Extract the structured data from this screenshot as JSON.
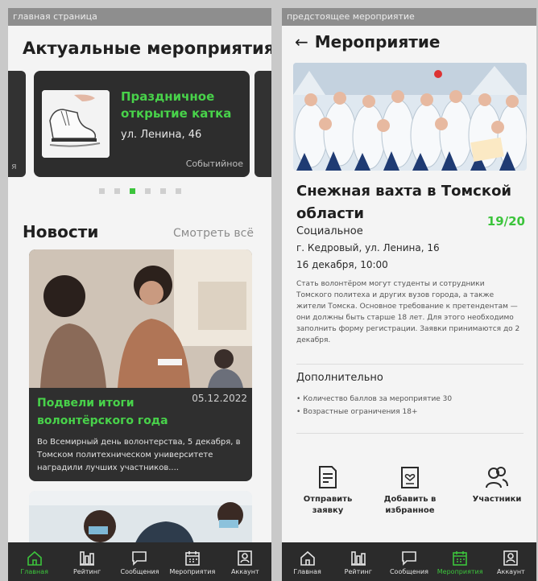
{
  "left_screen": {
    "caption": "главная страница",
    "section_title": "Актуальные мероприятия",
    "prev_card_fragment": "я",
    "event_card": {
      "title": "Праздничное открытие катка",
      "address": "ул. Ленина, 46",
      "category": "Событийное"
    },
    "carousel": {
      "total": 6,
      "active_index": 2
    },
    "news": {
      "title": "Новости",
      "see_all": "Смотреть всё",
      "card": {
        "date": "05.12.2022",
        "title": "Подвели итоги волонтёрского года",
        "text": "Во Всемирный день волонтерства, 5 декабря, в Томском политехническом университете наградили лучших участников...."
      }
    },
    "tabbar": {
      "active": "home",
      "items": [
        {
          "id": "home",
          "label": "Главная",
          "icon": "home-icon"
        },
        {
          "id": "rating",
          "label": "Рейтинг",
          "icon": "chart-icon"
        },
        {
          "id": "messages",
          "label": "Сообщения",
          "icon": "message-icon"
        },
        {
          "id": "events",
          "label": "Мероприятия",
          "icon": "calendar-icon"
        },
        {
          "id": "account",
          "label": "Аккаунт",
          "icon": "user-icon"
        }
      ]
    }
  },
  "right_screen": {
    "caption": "предстоящее мероприятие",
    "header_title": "Мероприятие",
    "event": {
      "title": "Снежная вахта в Томской области",
      "participants": "19/20",
      "category": "Социальное",
      "address": "г. Кедровый, ул. Ленина, 16",
      "datetime": "16 декабря, 10:00",
      "description": "Стать волонтёром могут студенты и сотрудники Томского политеха и других вузов города, а также жители Томска. Основное требование к претендентам — они должны быть старше 18 лет. Для этого необходимо заполнить форму регистрации. Заявки принимаются до 2 декабря."
    },
    "extra": {
      "title": "Дополнительно",
      "items": [
        "Количество баллов за мероприятие 30",
        "Возрастные ограничения 18+"
      ]
    },
    "actions": [
      {
        "label": "Отправить заявку",
        "icon": "document-icon"
      },
      {
        "label": "Добавить в избранное",
        "icon": "favorite-clipboard-icon"
      },
      {
        "label": "Участники",
        "icon": "participants-icon"
      }
    ],
    "tabbar": {
      "active": "events",
      "items": [
        {
          "id": "home",
          "label": "Главная",
          "icon": "home-icon"
        },
        {
          "id": "rating",
          "label": "Рейтинг",
          "icon": "chart-icon"
        },
        {
          "id": "messages",
          "label": "Сообщения",
          "icon": "message-icon"
        },
        {
          "id": "events",
          "label": "Мероприятия",
          "icon": "calendar-icon"
        },
        {
          "id": "account",
          "label": "Аккаунт",
          "icon": "user-icon"
        }
      ]
    }
  },
  "colors": {
    "accent": "#3cc43c",
    "dark_card": "#2d2d2d",
    "tabbar": "#2b2b2b"
  }
}
